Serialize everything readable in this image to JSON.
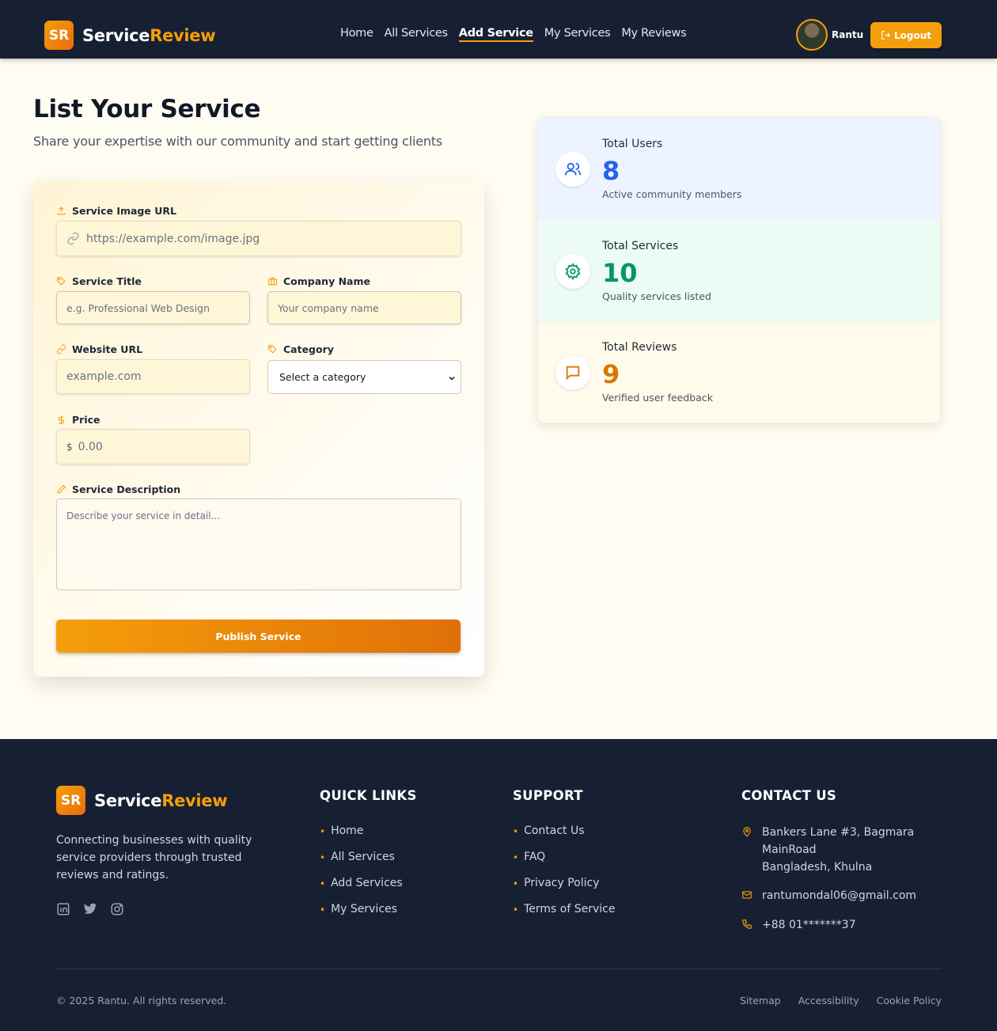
{
  "brand": {
    "badge": "SR",
    "name_part1": "Service",
    "name_part2": "Review"
  },
  "nav": {
    "links": [
      "Home",
      "All Services",
      "Add Service",
      "My Services",
      "My Reviews"
    ],
    "active": "Add Service",
    "user_name": "Rantu",
    "logout_label": "Logout"
  },
  "page": {
    "title": "List Your Service",
    "subtitle": "Share your expertise with our community and start getting clients"
  },
  "form": {
    "image_url": {
      "label": "Service Image URL",
      "placeholder": "https://example.com/image.jpg"
    },
    "title": {
      "label": "Service Title",
      "placeholder": "e.g. Professional Web Design"
    },
    "company": {
      "label": "Company Name",
      "placeholder": "Your company name"
    },
    "website": {
      "label": "Website URL",
      "placeholder": "example.com"
    },
    "category": {
      "label": "Category",
      "selected": "Select a category"
    },
    "price": {
      "label": "Price",
      "currency": "$",
      "placeholder": "0.00"
    },
    "description": {
      "label": "Service Description",
      "placeholder": "Describe your service in detail..."
    },
    "submit_label": "Publish Service"
  },
  "stats": [
    {
      "label": "Total Users",
      "value": "8",
      "desc": "Active community members",
      "icon": "users-icon",
      "color": "#2563eb",
      "bg": "#eef4ff"
    },
    {
      "label": "Total Services",
      "value": "10",
      "desc": "Quality services listed",
      "icon": "gear-icon",
      "color": "#059669",
      "bg": "#ecfbf4"
    },
    {
      "label": "Total Reviews",
      "value": "9",
      "desc": "Verified user feedback",
      "icon": "chat-icon",
      "color": "#d97706",
      "bg": "#fffbea"
    }
  ],
  "footer": {
    "description": "Connecting businesses with quality service providers through trusted reviews and ratings.",
    "quick_links": {
      "heading": "QUICK LINKS",
      "items": [
        "Home",
        "All Services",
        "Add Services",
        "My Services"
      ]
    },
    "support": {
      "heading": "SUPPORT",
      "items": [
        "Contact Us",
        "FAQ",
        "Privacy Policy",
        "Terms of Service"
      ]
    },
    "contact": {
      "heading": "CONTACT US",
      "address_line1": "Bankers Lane #3, Bagmara",
      "address_line2": "MainRoad",
      "address_line3": "Bangladesh, Khulna",
      "email": "rantumondal06@gmail.com",
      "phone": "+88 01*******37"
    },
    "copyright": "© 2025 Rantu. All rights reserved.",
    "bottom_links": [
      "Sitemap",
      "Accessibility",
      "Cookie Policy"
    ]
  },
  "colors": {
    "accent": "#f59e0b",
    "nav_bg": "#172033"
  }
}
